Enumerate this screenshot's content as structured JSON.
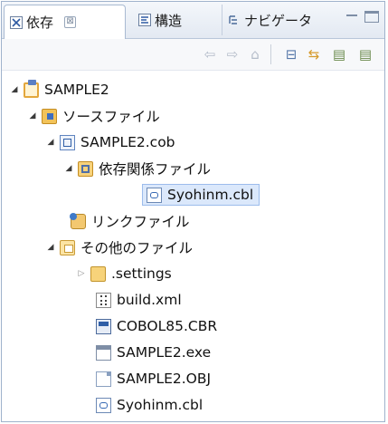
{
  "tabs": [
    {
      "label": "依存",
      "close": "⊠",
      "icon": "dependency-view-icon",
      "active": true
    },
    {
      "label": "構造",
      "icon": "structure-view-icon",
      "active": false
    },
    {
      "label": "ナビゲータ",
      "icon": "navigator-view-icon",
      "active": false
    }
  ],
  "window_buttons": [
    "minimize-icon",
    "maximize-icon"
  ],
  "toolbar": {
    "back": "⇦",
    "forward": "⇨",
    "home": "⌂",
    "collapse": "⊟",
    "link": "⇆",
    "icon_a": "▤",
    "icon_b": "▤"
  },
  "tree": [
    {
      "label": "SAMPLE2",
      "icon": "cobol-project-icon",
      "expanded": true
    },
    {
      "label": "ソースファイル",
      "icon": "source-folder-icon",
      "expanded": true
    },
    {
      "label": "SAMPLE2.cob",
      "icon": "cobol-source-icon",
      "expanded": true
    },
    {
      "label": "依存関係ファイル",
      "icon": "dependency-folder-icon",
      "expanded": true
    },
    {
      "label": "Syohinm.cbl",
      "icon": "copybook-icon",
      "selected": true
    },
    {
      "label": "リンクファイル",
      "icon": "link-file-icon"
    },
    {
      "label": "その他のファイル",
      "icon": "other-files-folder-icon",
      "expanded": true
    },
    {
      "label": ".settings",
      "icon": "folder-icon",
      "expanded": false
    },
    {
      "label": "build.xml",
      "icon": "xml-file-icon"
    },
    {
      "label": "COBOL85.CBR",
      "icon": "cbr-file-icon"
    },
    {
      "label": "SAMPLE2.exe",
      "icon": "exe-file-icon"
    },
    {
      "label": "SAMPLE2.OBJ",
      "icon": "obj-file-icon"
    },
    {
      "label": "Syohinm.cbl",
      "icon": "copybook-icon"
    }
  ],
  "colors": {
    "selection_bg": "#dbe8fb",
    "selection_border": "#9cbcec",
    "tabbar_bg": "#e3e9f2"
  }
}
